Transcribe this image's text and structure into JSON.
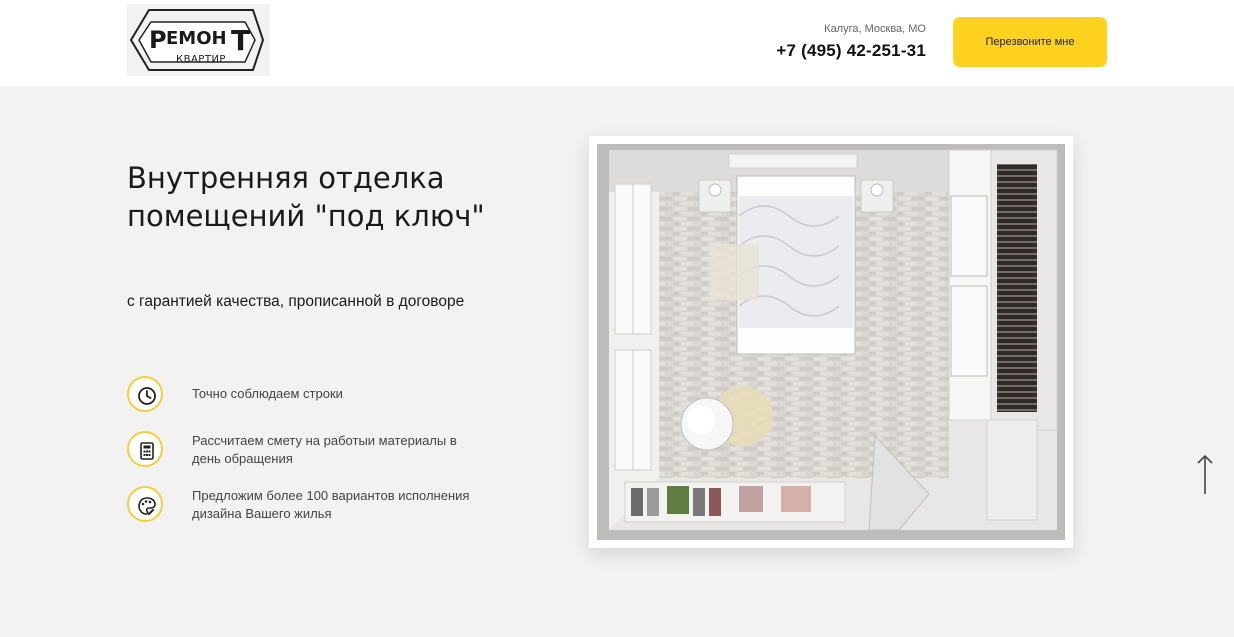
{
  "header": {
    "logo": {
      "text_main": "Ремонт",
      "text_sub": "квартир"
    },
    "city": "Калуга, Москва, МО",
    "phone": "+7 (495) 42-251-31",
    "callback_label": "Перезвоните мне"
  },
  "hero": {
    "title": "Внутренняя отделка помещений \"под ключ\"",
    "subtitle": "с гарантией качества, прописанной в договоре",
    "features": [
      {
        "icon": "clock-icon",
        "text": "Точно соблюдаем строки"
      },
      {
        "icon": "calculator-icon",
        "text": "Рассчитаем смету на работыи материалы в день обращения"
      },
      {
        "icon": "palette-icon",
        "text": "Предложим более 100 вариантов исполнения дизайна Вашего жилья"
      }
    ],
    "image": "room-floorplan-render"
  },
  "scroll_top_icon": "arrow-up-icon",
  "colors": {
    "accent": "#ffd21f",
    "icon_ring": "#f3cf3b",
    "hero_bg": "#f2f2f2"
  }
}
